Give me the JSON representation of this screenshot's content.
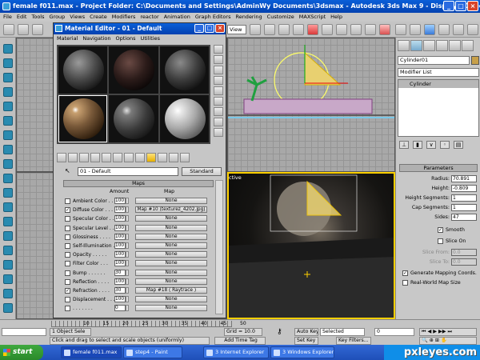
{
  "app": {
    "title": "female f011.max     - Project Folder: C:\\Documents and Settings\\AdminWy Documents\\3dsmax     - Autodesk 3ds Max 9     - Display : Direct 3D"
  },
  "menu": [
    "File",
    "Edit",
    "Tools",
    "Group",
    "Views",
    "Create",
    "Modifiers",
    "reactor",
    "Animation",
    "Graph Editors",
    "Rendering",
    "Customize",
    "MAXScript",
    "Help"
  ],
  "toolbar": {
    "view_dropdown": "View"
  },
  "material_editor": {
    "title": "Material Editor - 01 - Default",
    "menu": [
      "Material",
      "Navigation",
      "Options",
      "Utilities"
    ],
    "material_name": "01 - Default",
    "type_button": "Standard",
    "maps_rollout": "Maps",
    "header_amount": "Amount",
    "header_map": "Map",
    "maps": [
      {
        "checked": false,
        "name": "Ambient Color . . .",
        "amount": "100",
        "map": "None"
      },
      {
        "checked": true,
        "name": "Diffuse Color . . .",
        "amount": "100",
        "map": "Map #10 (texturez_4202.jpg)"
      },
      {
        "checked": false,
        "name": "Specular Color . .",
        "amount": "100",
        "map": "None"
      },
      {
        "checked": false,
        "name": "Specular Level . .",
        "amount": "100",
        "map": "None"
      },
      {
        "checked": false,
        "name": "Glossiness . . . .",
        "amount": "100",
        "map": "None"
      },
      {
        "checked": false,
        "name": "Self-Illumination .",
        "amount": "100",
        "map": "None"
      },
      {
        "checked": false,
        "name": "Opacity . . . . .",
        "amount": "100",
        "map": "None"
      },
      {
        "checked": false,
        "name": "Filter Color . . .",
        "amount": "100",
        "map": "None"
      },
      {
        "checked": false,
        "name": "Bump . . . . . .",
        "amount": "30",
        "map": "None"
      },
      {
        "checked": false,
        "name": "Reflection . . . .",
        "amount": "100",
        "map": "None"
      },
      {
        "checked": true,
        "name": "Refraction . . . .",
        "amount": "30",
        "map": "Map #18  ( Raytrace )"
      },
      {
        "checked": false,
        "name": "Displacement . . .",
        "amount": "100",
        "map": "None"
      },
      {
        "checked": false,
        "name": ". . . . . . .",
        "amount": "0",
        "map": "None"
      }
    ]
  },
  "viewport": {
    "active_label": "ctive"
  },
  "command_panel": {
    "object_name": "Cylinder01",
    "modifier_list": "Modifier List",
    "stack_item": "Cylinder",
    "parameters_title": "Parameters",
    "params": [
      {
        "label": "Radius:",
        "value": "70.891"
      },
      {
        "label": "Height:",
        "value": "-0.809"
      },
      {
        "label": "Height Segments:",
        "value": "1"
      },
      {
        "label": "Cap Segments:",
        "value": "1"
      },
      {
        "label": "Sides:",
        "value": "47"
      }
    ],
    "smooth_label": "Smooth",
    "slice_on_label": "Slice On",
    "slice_from_label": "Slice From:",
    "slice_from_value": "0.0",
    "slice_to_label": "Slice To:",
    "slice_to_value": "0.0",
    "gen_mapping_label": "Generate Mapping Coords.",
    "real_world_label": "Real-World Map Size"
  },
  "timeline": {
    "ticks": [
      "10",
      "15",
      "20",
      "25",
      "30",
      "35",
      "40",
      "45",
      "50"
    ]
  },
  "status": {
    "selection": "1 Object Sele",
    "grid": "Grid = 10.0",
    "prompt": "Click and drag to select and scale objects (uniformly)",
    "add_time_tag": "Add Time Tag",
    "auto_key": "Auto Key",
    "selected": "Selected",
    "set_key": "Set Key",
    "key_filters": "Key Filters...",
    "frame": "0"
  },
  "taskbar": {
    "start": "start",
    "tasks": [
      "female f011.max",
      "step4 - Paint",
      "3 Internet Explorer",
      "3 Windows Explorer"
    ],
    "watermark": "pxleyes.com"
  }
}
